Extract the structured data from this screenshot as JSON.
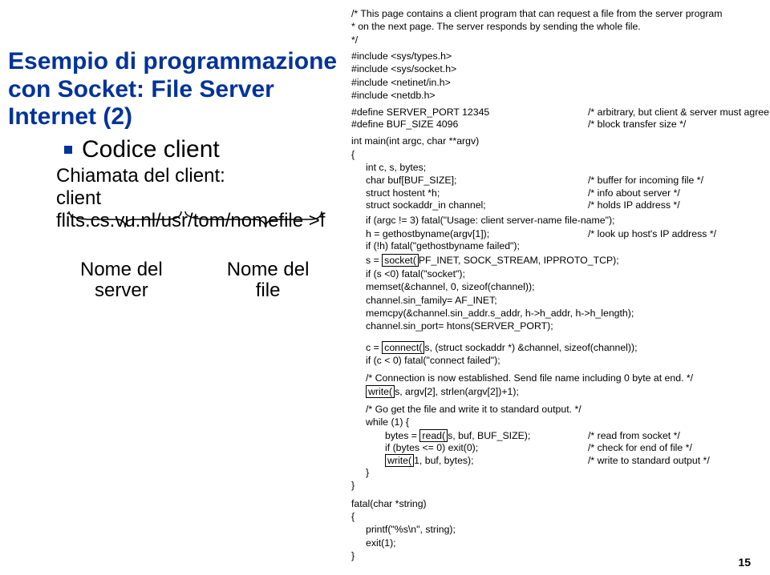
{
  "left": {
    "title_l1": "Esempio di programmazione",
    "title_l2": "con Socket: File Server",
    "title_l3": "Internet (2)",
    "bullet": "Codice client",
    "sub1": "Chiamata del client:",
    "sub2": "client flits.cs.vu.nl/usr/tom/nomefile >f",
    "label1_l1": "Nome del",
    "label1_l2": "server",
    "label2_l1": "Nome del",
    "label2_l2": "file"
  },
  "code": {
    "c1": "/* This page contains a client program that can request a file from the server program",
    "c2": " * on the next page. The server responds by sending the whole file.",
    "c3": " */",
    "inc1": "#include <sys/types.h>",
    "inc2": "#include <sys/socket.h>",
    "inc3": "#include <netinet/in.h>",
    "inc4": "#include <netdb.h>",
    "def1a": "#define SERVER_PORT 12345",
    "def1b": "/* arbitrary, but client & server must agree *",
    "def2a": "#define BUF_SIZE 4096",
    "def2b": "/* block transfer size */",
    "main1": "int main(int argc, char **argv)",
    "main2": "{",
    "v1": "int c, s, bytes;",
    "v2a": "char buf[BUF_SIZE];",
    "v2b": "/* buffer for incoming file */",
    "v3a": "struct hostent *h;",
    "v3b": "/* info about server */",
    "v4a": "struct sockaddr_in channel;",
    "v4b": "/* holds IP address */",
    "b1": "if (argc != 3) fatal(\"Usage: client server-name file-name\");",
    "b2a": "h = gethostbyname(argv[1]);",
    "b2b": "/* look up host's IP address */",
    "b3": "if (!h) fatal(\"gethostbyname failed\");",
    "s1a": "s = ",
    "s1box": "socket(",
    "s1b": "PF_INET, SOCK_STREAM, IPPROTO_TCP);",
    "s2": "if (s <0) fatal(\"socket\");",
    "s3": "memset(&channel, 0, sizeof(channel));",
    "s4": "channel.sin_family= AF_INET;",
    "s5": "memcpy(&channel.sin_addr.s_addr, h->h_addr, h->h_length);",
    "s6": "channel.sin_port= htons(SERVER_PORT);",
    "cn1a": "c = ",
    "cn1box": "connect(",
    "cn1b": "s, (struct sockaddr *) &channel, sizeof(channel));",
    "cn2": "if (c < 0) fatal(\"connect failed\");",
    "wr_c": "/* Connection is now established. Send file name including 0 byte at end. */",
    "wr1box": "write(",
    "wr1b": "s, argv[2], strlen(argv[2])+1);",
    "gg_c": "/* Go get the file and write it to standard output. */",
    "gg1": "while (1) {",
    "rd1a": "bytes = ",
    "rd1box": "read(",
    "rd1b": "s, buf, BUF_SIZE);",
    "rd1c": "/* read from socket */",
    "rd2a": "if (bytes <= 0) exit(0);",
    "rd2b": "/* check for end of file */",
    "wr2box": "write(",
    "wr2b": "1, buf, bytes);",
    "wr2c": "/* write to standard output */",
    "cb1": "}",
    "cb2": "}",
    "f1": "fatal(char *string)",
    "f2": "{",
    "f3": "printf(\"%s\\n\", string);",
    "f4": "exit(1);",
    "f5": "}"
  },
  "pagenum": "15"
}
